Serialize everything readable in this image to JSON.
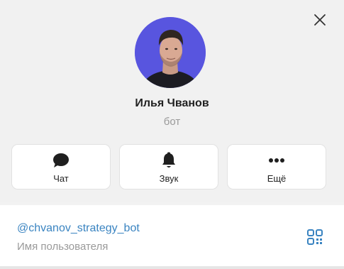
{
  "profile": {
    "name": "Илья Чванов",
    "subtitle": "бот"
  },
  "actions": [
    {
      "label": "Чат",
      "icon": "chat-bubble-icon"
    },
    {
      "label": "Звук",
      "icon": "bell-icon"
    },
    {
      "label": "Ещё",
      "icon": "more-dots-icon"
    }
  ],
  "info": {
    "username": "@chvanov_strategy_bot",
    "username_caption": "Имя пользователя",
    "qr_icon": "qr-code-icon"
  },
  "colors": {
    "accent": "#3a84c1",
    "avatar_bg": "#5a56e0",
    "header_bg": "#f1f1f1"
  }
}
